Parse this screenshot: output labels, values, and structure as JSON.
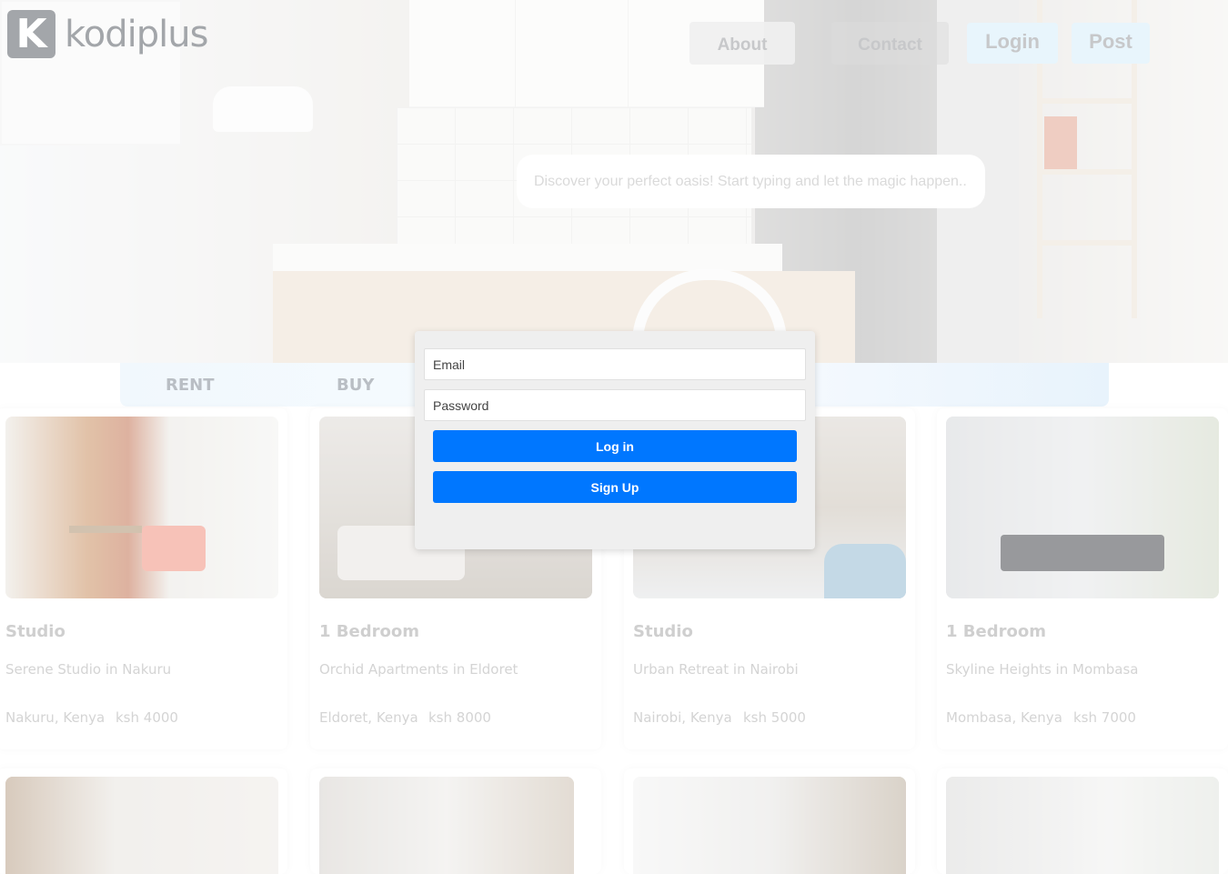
{
  "header": {
    "logo_text": "kodiplus",
    "logo_letter": "K",
    "nav": {
      "about": "About",
      "contact": "Contact",
      "login": "Login",
      "post": "Post"
    }
  },
  "search": {
    "placeholder": "Discover your perfect oasis! Start typing and let the magic happen...."
  },
  "tabs": {
    "rent": "RENT",
    "buy": "BUY"
  },
  "listings": [
    {
      "type": "Studio",
      "title": "Serene Studio in Nakuru",
      "location": "Nakuru, Kenya",
      "price": "ksh 4000"
    },
    {
      "type": "1 Bedroom",
      "title": "Orchid Apartments in Eldoret",
      "location": "Eldoret, Kenya",
      "price": "ksh 8000"
    },
    {
      "type": "Studio",
      "title": "Urban Retreat in Nairobi",
      "location": "Nairobi, Kenya",
      "price": "ksh 5000"
    },
    {
      "type": "1 Bedroom",
      "title": "Skyline Heights in Mombasa",
      "location": "Mombasa, Kenya",
      "price": "ksh 7000"
    }
  ],
  "login_modal": {
    "email_placeholder": "Email",
    "password_placeholder": "Password",
    "login_label": "Log in",
    "signup_label": "Sign Up"
  },
  "colors": {
    "accent": "#0077ff",
    "nav_highlight": "#e8f5fc"
  }
}
